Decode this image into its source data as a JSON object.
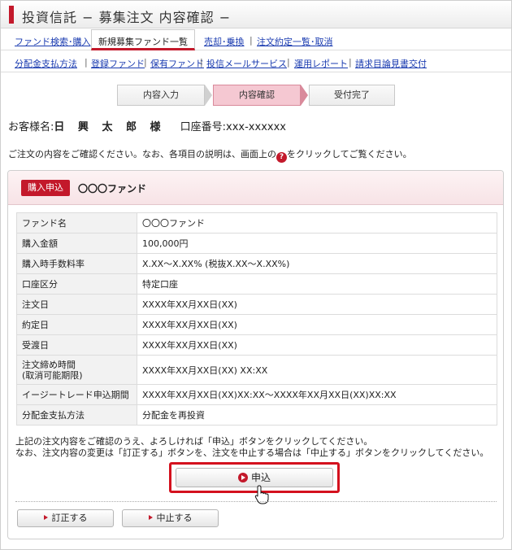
{
  "header": {
    "title": "投資信託 − 募集注文 内容確認 −"
  },
  "nav_primary": [
    {
      "label": "ファンド検索･購入",
      "active": false
    },
    {
      "label": "新規募集ファンド一覧",
      "active": true
    },
    {
      "label": "売却･乗換",
      "active": false
    },
    {
      "label": "注文約定一覧･取消",
      "active": false
    }
  ],
  "nav_secondary": [
    {
      "label": "分配金支払方法"
    },
    {
      "label": "登録ファンド"
    },
    {
      "label": "保有ファンド"
    },
    {
      "label": "投信メールサービス"
    },
    {
      "label": "運用レポート"
    },
    {
      "label": "請求目論見書交付"
    }
  ],
  "steps": [
    {
      "label": "内容入力",
      "current": false
    },
    {
      "label": "内容確認",
      "current": true
    },
    {
      "label": "受付完了",
      "current": false
    }
  ],
  "customer": {
    "name_label": "お客様名:",
    "name": "日 興 太 郎 様",
    "account_label": "口座番号:",
    "account": "xxx-xxxxxx"
  },
  "intro": {
    "before_icon": "ご注文の内容をご確認ください。なお、各項目の説明は、画面上の",
    "icon_glyph": "?",
    "after_icon": "をクリックしてご覧ください。"
  },
  "order": {
    "badge": "購入申込",
    "fund_name": "〇〇〇ファンド",
    "rows": [
      {
        "key": "ファンド名",
        "value": "〇〇〇ファンド"
      },
      {
        "key": "購入金額",
        "value": "100,000円"
      },
      {
        "key": "購入時手数料率",
        "value": "X.XX〜X.XX% (税抜X.XX〜X.XX%)"
      },
      {
        "key": "口座区分",
        "value": "特定口座"
      },
      {
        "key": "注文日",
        "value": "XXXX年XX月XX日(XX)"
      },
      {
        "key": "約定日",
        "value": "XXXX年XX月XX日(XX)"
      },
      {
        "key": "受渡日",
        "value": "XXXX年XX月XX日(XX)"
      },
      {
        "key": "注文締め時間\n(取消可能期限)",
        "value": "XXXX年XX月XX日(XX) XX:XX"
      },
      {
        "key": "イージートレード申込期間",
        "value": "XXXX年XX月XX日(XX)XX:XX〜XXXX年XX月XX日(XX)XX:XX"
      },
      {
        "key": "分配金支払方法",
        "value": "分配金を再投資"
      }
    ]
  },
  "notes": {
    "line1": "上記の注文内容をご確認のうえ、よろしければ「申込」ボタンをクリックしてください。",
    "line2": "なお、注文内容の変更は「訂正する」ボタンを、注文を中止する場合は「中止する」ボタンをクリックしてください。"
  },
  "buttons": {
    "submit": "申込",
    "correct": "訂正する",
    "cancel": "中止する"
  },
  "colors": {
    "brand": "#c3192b",
    "highlight": "#d4111e",
    "current_step": "#f5c8d2"
  }
}
